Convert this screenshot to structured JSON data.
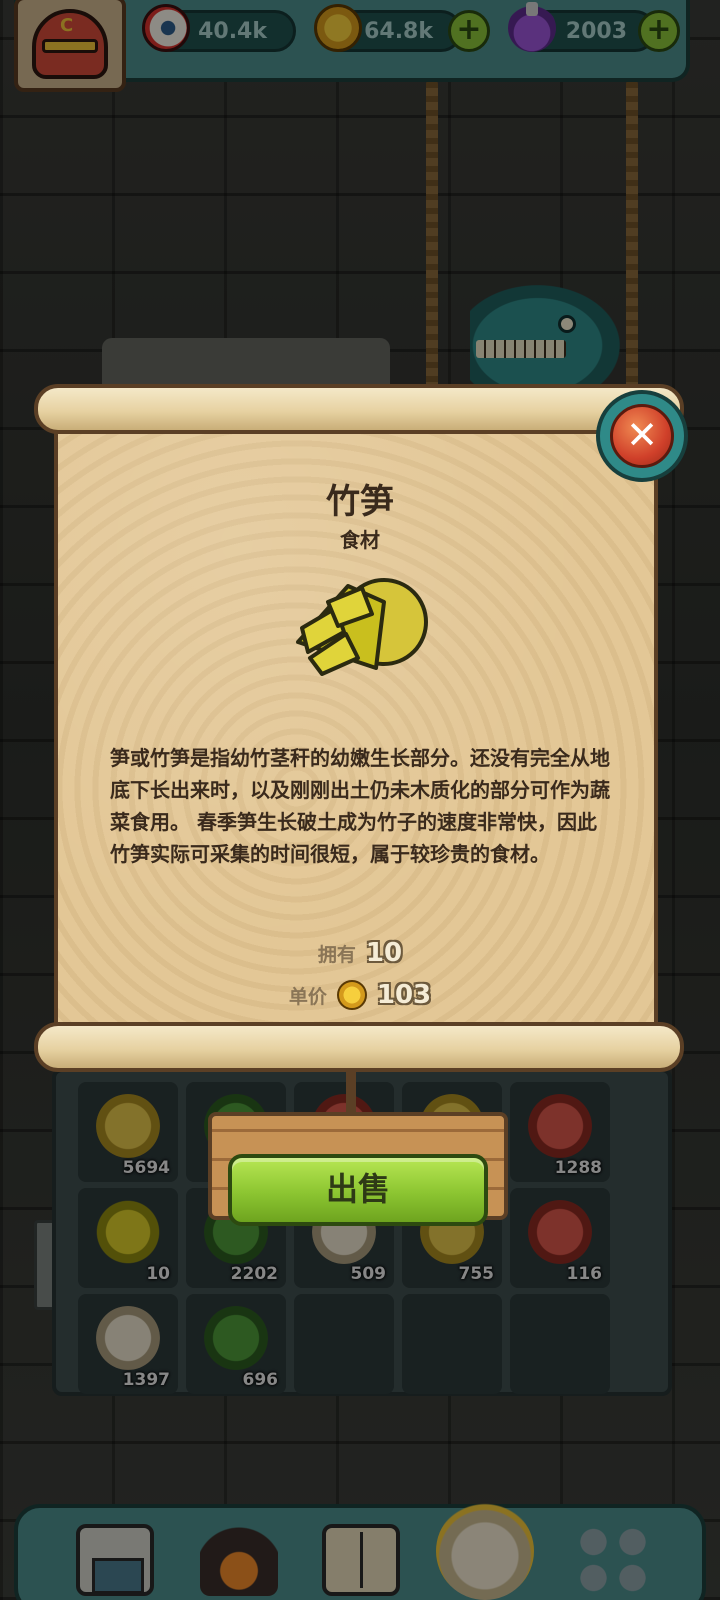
{
  "resources": {
    "eyes": "40.4k",
    "coins": "64.8k",
    "potions": "2003",
    "plus": "+"
  },
  "popup": {
    "close_label": "✕",
    "item_name": "竹笋",
    "item_category": "食材",
    "description": "笋或竹笋是指幼竹茎秆的幼嫩生长部分。还没有完全从地底下长出来时，以及刚刚出土仍未木质化的部分可作为蔬菜食用。 春季笋生长破土成为竹子的速度非常快，因此竹笋实际可采集的时间很短，属于较珍贵的食材。",
    "owned_label": "拥有",
    "owned_value": "10",
    "price_label": "单价",
    "price_value": "103",
    "sell_label": "出售"
  },
  "inventory": {
    "slots": [
      {
        "count": "5694",
        "icon": "potato-icon"
      },
      {
        "count": "",
        "icon": "vegetable-icon"
      },
      {
        "count": "",
        "icon": "meat-icon"
      },
      {
        "count": "",
        "icon": "honeycomb-icon"
      },
      {
        "count": "1288",
        "icon": "steak-icon"
      },
      {
        "count": "10",
        "icon": "bamboo-shoot-icon"
      },
      {
        "count": "2202",
        "icon": "vegetable-icon"
      },
      {
        "count": "509",
        "icon": "item-icon"
      },
      {
        "count": "755",
        "icon": "item-icon"
      },
      {
        "count": "116",
        "icon": "meat-icon"
      },
      {
        "count": "1397",
        "icon": "shell-icon"
      },
      {
        "count": "696",
        "icon": "broccoli-icon"
      },
      {
        "count": "",
        "icon": "empty-slot"
      },
      {
        "count": "",
        "icon": "empty-slot"
      },
      {
        "count": "",
        "icon": "empty-slot"
      }
    ]
  },
  "nav": {
    "items": [
      "shop-icon",
      "cooking-icon",
      "recipe-book-icon",
      "sell-bag-icon",
      "collection-grid-icon"
    ]
  },
  "colors": {
    "teal_frame": "#4c8e8c",
    "parchment": "#e3c796",
    "sell_green": "#8cc531",
    "close_red": "#d0402a"
  }
}
